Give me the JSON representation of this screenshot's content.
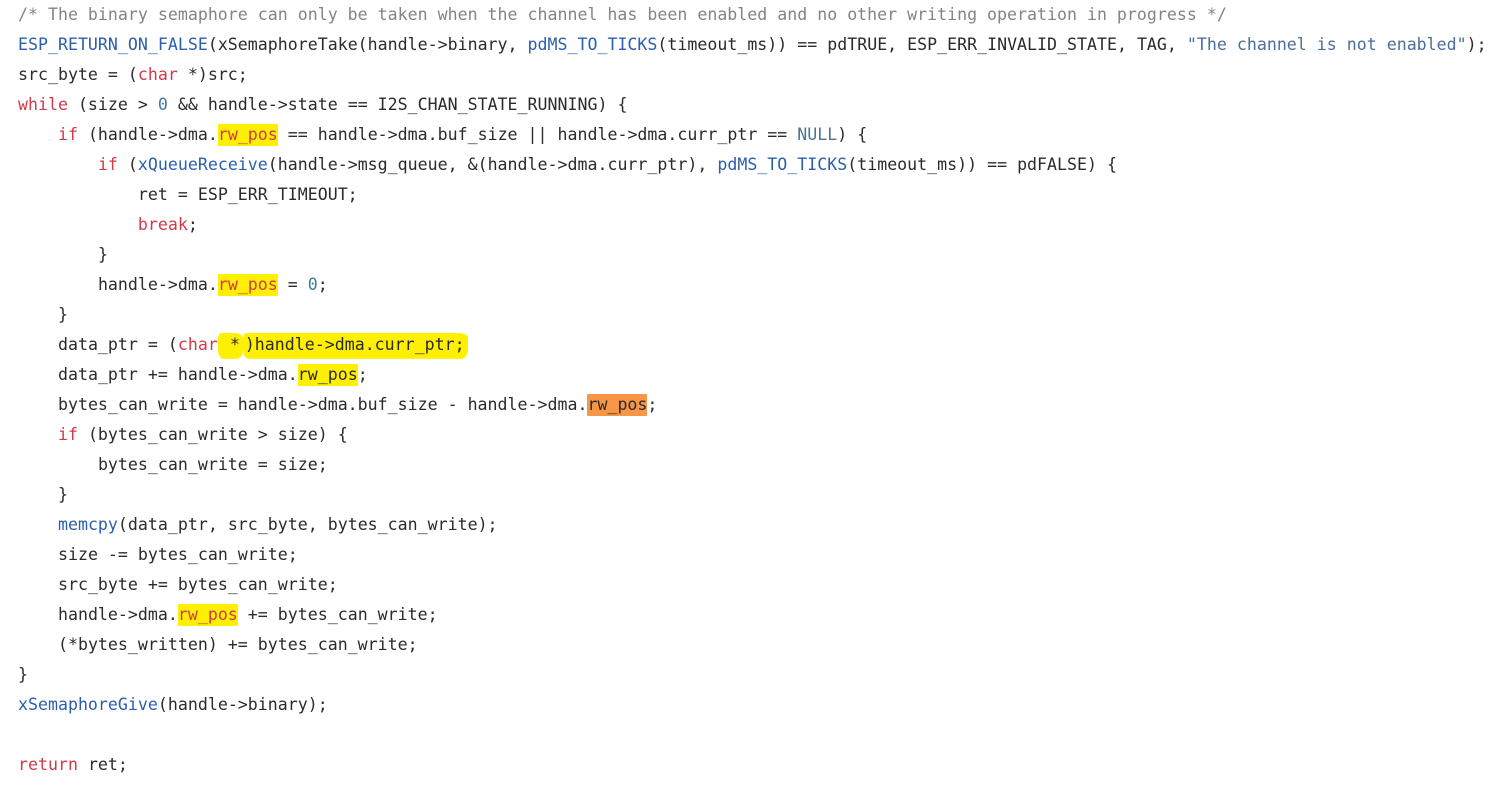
{
  "editor": {
    "title": "i2s_channel_write source excerpt",
    "language": "c",
    "background": "#ffffff",
    "font_size_px": 16.6,
    "line_height_px": 30,
    "colors": {
      "text": "#2b2b2b",
      "comment": "#848484",
      "keyword": "#d33a49",
      "function": "#2b5fad",
      "macro": "#2b5fad",
      "string": "#4a6f9c",
      "constant": "#49758f",
      "number": "#3f7a9e",
      "highlight_yellow": "#ffef00",
      "highlight_orange": "#f79646"
    }
  },
  "lines": [
    {
      "id": "line-1",
      "indent": 0,
      "tokens": [
        {
          "t": "/* The binary semaphore can only be taken when the channel has been enabled and no other writing operation in progress */",
          "c": "tok-comment"
        }
      ]
    },
    {
      "id": "line-2",
      "indent": 0,
      "tokens": [
        {
          "t": "ESP_RETURN_ON_FALSE",
          "c": "tok-macro"
        },
        {
          "t": "(xSemaphoreTake(handle->binary, ",
          "c": "tok-plain"
        },
        {
          "t": "pdMS_TO_TICKS",
          "c": "tok-func"
        },
        {
          "t": "(timeout_ms)) == pdTRUE, ESP_ERR_INVALID_STATE, TAG, ",
          "c": "tok-plain"
        },
        {
          "t": "\"The channel is not enabled\"",
          "c": "tok-string"
        },
        {
          "t": ");",
          "c": "tok-plain"
        }
      ]
    },
    {
      "id": "line-3",
      "indent": 0,
      "tokens": [
        {
          "t": "src_byte = (",
          "c": "tok-plain"
        },
        {
          "t": "char",
          "c": "tok-keyword"
        },
        {
          "t": " *)src;",
          "c": "tok-plain"
        }
      ]
    },
    {
      "id": "line-4",
      "indent": 0,
      "tokens": [
        {
          "t": "while",
          "c": "tok-keyword"
        },
        {
          "t": " (size > ",
          "c": "tok-plain"
        },
        {
          "t": "0",
          "c": "tok-number"
        },
        {
          "t": " && handle->state == I2S_CHAN_STATE_RUNNING) {",
          "c": "tok-plain"
        }
      ]
    },
    {
      "id": "line-5",
      "indent": 1,
      "tokens": [
        {
          "t": "if",
          "c": "tok-keyword"
        },
        {
          "t": " (handle->dma.",
          "c": "tok-plain"
        },
        {
          "t": "rw_pos",
          "c": "tok-keyword",
          "h": "hl-yellow"
        },
        {
          "t": " == handle->dma.buf_size || handle->dma.curr_ptr == ",
          "c": "tok-plain"
        },
        {
          "t": "NULL",
          "c": "tok-const"
        },
        {
          "t": ") {",
          "c": "tok-plain"
        }
      ]
    },
    {
      "id": "line-6",
      "indent": 2,
      "tokens": [
        {
          "t": "if",
          "c": "tok-keyword"
        },
        {
          "t": " (",
          "c": "tok-plain"
        },
        {
          "t": "xQueueReceive",
          "c": "tok-func"
        },
        {
          "t": "(handle->msg_queue, &(handle->dma.curr_ptr), ",
          "c": "tok-plain"
        },
        {
          "t": "pdMS_TO_TICKS",
          "c": "tok-func"
        },
        {
          "t": "(timeout_ms)) == pdFALSE) {",
          "c": "tok-plain"
        }
      ]
    },
    {
      "id": "line-7",
      "indent": 3,
      "tokens": [
        {
          "t": "ret = ESP_ERR_TIMEOUT;",
          "c": "tok-plain"
        }
      ]
    },
    {
      "id": "line-8",
      "indent": 3,
      "tokens": [
        {
          "t": "break",
          "c": "tok-keyword"
        },
        {
          "t": ";",
          "c": "tok-plain"
        }
      ]
    },
    {
      "id": "line-9",
      "indent": 2,
      "tokens": [
        {
          "t": "}",
          "c": "tok-plain"
        }
      ]
    },
    {
      "id": "line-10",
      "indent": 2,
      "tokens": [
        {
          "t": "handle->dma.",
          "c": "tok-plain"
        },
        {
          "t": "rw_pos",
          "c": "tok-keyword",
          "h": "hl-yellow"
        },
        {
          "t": " = ",
          "c": "tok-plain"
        },
        {
          "t": "0",
          "c": "tok-number"
        },
        {
          "t": ";",
          "c": "tok-plain"
        }
      ]
    },
    {
      "id": "line-11",
      "indent": 1,
      "tokens": [
        {
          "t": "}",
          "c": "tok-plain"
        }
      ]
    },
    {
      "id": "line-12",
      "indent": 1,
      "tokens": [
        {
          "t": "data_ptr = (",
          "c": "tok-plain"
        },
        {
          "t": "char",
          "c": "tok-keyword"
        },
        {
          "t": " *",
          "c": "tok-plain",
          "h": "hl-marker-start"
        },
        {
          "t": ")handle->dma.curr_ptr;",
          "c": "tok-plain",
          "h": "hl-marker"
        }
      ]
    },
    {
      "id": "line-13",
      "indent": 1,
      "tokens": [
        {
          "t": "data_ptr += handle->dma.",
          "c": "tok-plain"
        },
        {
          "t": "rw_pos",
          "c": "tok-plain",
          "h": "hl-yellow"
        },
        {
          "t": ";",
          "c": "tok-plain"
        }
      ]
    },
    {
      "id": "line-14",
      "indent": 1,
      "tokens": [
        {
          "t": "bytes_can_write = handle->dma.buf_size - handle->dma.",
          "c": "tok-plain"
        },
        {
          "t": "rw_pos",
          "c": "tok-plain",
          "h": "hl-orange"
        },
        {
          "t": ";",
          "c": "tok-plain"
        }
      ]
    },
    {
      "id": "line-15",
      "indent": 1,
      "tokens": [
        {
          "t": "if",
          "c": "tok-keyword"
        },
        {
          "t": " (bytes_can_write > size) {",
          "c": "tok-plain"
        }
      ]
    },
    {
      "id": "line-16",
      "indent": 2,
      "tokens": [
        {
          "t": "bytes_can_write = size;",
          "c": "tok-plain"
        }
      ]
    },
    {
      "id": "line-17",
      "indent": 1,
      "tokens": [
        {
          "t": "}",
          "c": "tok-plain"
        }
      ]
    },
    {
      "id": "line-18",
      "indent": 1,
      "tokens": [
        {
          "t": "memcpy",
          "c": "tok-func"
        },
        {
          "t": "(data_ptr, src_byte, bytes_can_write);",
          "c": "tok-plain"
        }
      ]
    },
    {
      "id": "line-19",
      "indent": 1,
      "tokens": [
        {
          "t": "size -= bytes_can_write;",
          "c": "tok-plain"
        }
      ]
    },
    {
      "id": "line-20",
      "indent": 1,
      "tokens": [
        {
          "t": "src_byte += bytes_can_write;",
          "c": "tok-plain"
        }
      ]
    },
    {
      "id": "line-21",
      "indent": 1,
      "tokens": [
        {
          "t": "handle->dma.",
          "c": "tok-plain"
        },
        {
          "t": "rw_pos",
          "c": "tok-keyword",
          "h": "hl-yellow"
        },
        {
          "t": " += bytes_can_write;",
          "c": "tok-plain"
        }
      ]
    },
    {
      "id": "line-22",
      "indent": 1,
      "tokens": [
        {
          "t": "(*bytes_written) += bytes_can_write;",
          "c": "tok-plain"
        }
      ]
    },
    {
      "id": "line-23",
      "indent": 0,
      "tokens": [
        {
          "t": "}",
          "c": "tok-plain"
        }
      ]
    },
    {
      "id": "line-24",
      "indent": 0,
      "tokens": [
        {
          "t": "xSemaphoreGive",
          "c": "tok-func"
        },
        {
          "t": "(handle->binary);",
          "c": "tok-plain"
        }
      ]
    },
    {
      "id": "line-25",
      "indent": 0,
      "tokens": []
    },
    {
      "id": "line-26",
      "indent": 0,
      "tokens": [
        {
          "t": "return",
          "c": "tok-keyword"
        },
        {
          "t": " ret;",
          "c": "tok-plain"
        }
      ]
    }
  ]
}
